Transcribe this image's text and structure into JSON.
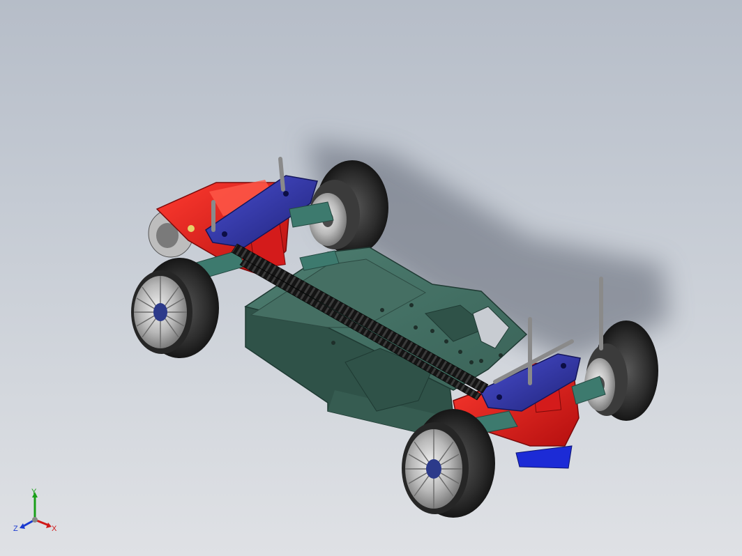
{
  "viewport": {
    "background_top": "#b6bdc8",
    "background_bottom": "#dfe1e5"
  },
  "model": {
    "subject": "rc-car-chassis-assembly",
    "colors": {
      "chassis": "#3f6b5f",
      "chassis_dark": "#2f5248",
      "gearbox": "#d11a1a",
      "suspension_mount": "#2b2f9c",
      "arms": "#3d7a6e",
      "tire": "#2a2a2a",
      "rim": "#c8c8c8",
      "belt": "#111111",
      "posts": "#9a9a9a"
    }
  },
  "triad": {
    "x_label": "X",
    "y_label": "Y",
    "z_label": "Z",
    "x_color": "#d01818",
    "y_color": "#19a019",
    "z_color": "#1a3ad0"
  }
}
